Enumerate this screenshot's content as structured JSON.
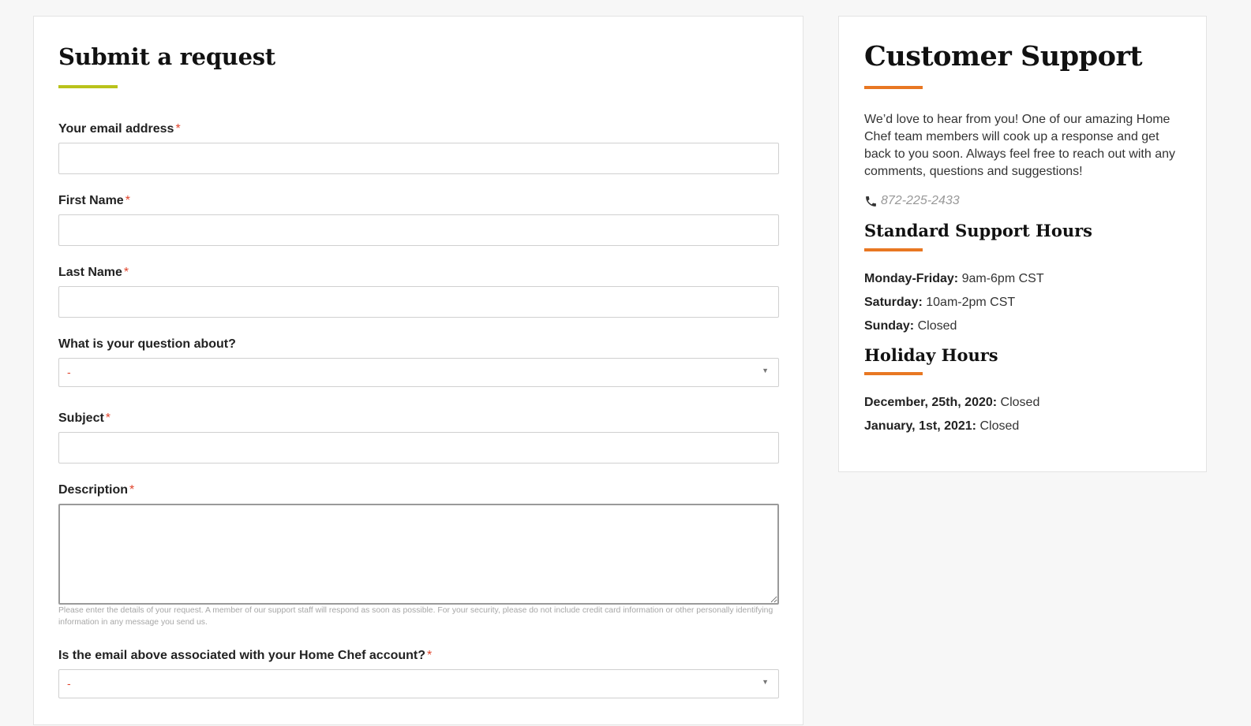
{
  "form": {
    "title": "Submit a request",
    "fields": {
      "email": {
        "label": "Your email address",
        "required_mark": "*",
        "value": ""
      },
      "first_name": {
        "label": "First Name",
        "required_mark": "*",
        "value": ""
      },
      "last_name": {
        "label": "Last Name",
        "required_mark": "*",
        "value": ""
      },
      "question_about": {
        "label": "What is your question about?",
        "selected": "-"
      },
      "subject": {
        "label": "Subject",
        "required_mark": "*",
        "value": ""
      },
      "description": {
        "label": "Description",
        "required_mark": "*",
        "value": "",
        "hint": "Please enter the details of your request. A member of our support staff will respond as soon as possible. For your security, please do not include credit card information or other personally identifying information in any message you send us."
      },
      "account_association": {
        "label": "Is the email above associated with your Home Chef account?",
        "required_mark": "*",
        "selected": "-"
      }
    }
  },
  "support": {
    "title": "Customer Support",
    "intro": "We’d love to hear from you! One of our amazing Home Chef team members will cook up a response and get back to you soon. Always feel free to reach out with any comments, questions and suggestions!",
    "phone": "872-225-2433",
    "phone_icon": "phone-icon",
    "standard_hours": {
      "title": "Standard Support Hours",
      "rows": [
        {
          "day": "Monday-Friday:",
          "hours": "9am-6pm CST"
        },
        {
          "day": "Saturday:",
          "hours": "10am-2pm CST"
        },
        {
          "day": "Sunday:",
          "hours": "Closed"
        }
      ]
    },
    "holiday_hours": {
      "title": "Holiday Hours",
      "rows": [
        {
          "day": "December, 25th, 2020:",
          "hours": "Closed"
        },
        {
          "day": "January, 1st, 2021:",
          "hours": "Closed"
        }
      ]
    }
  },
  "colors": {
    "accent_green": "#b9c21b",
    "accent_orange": "#e87722",
    "required_red": "#e0442c"
  }
}
